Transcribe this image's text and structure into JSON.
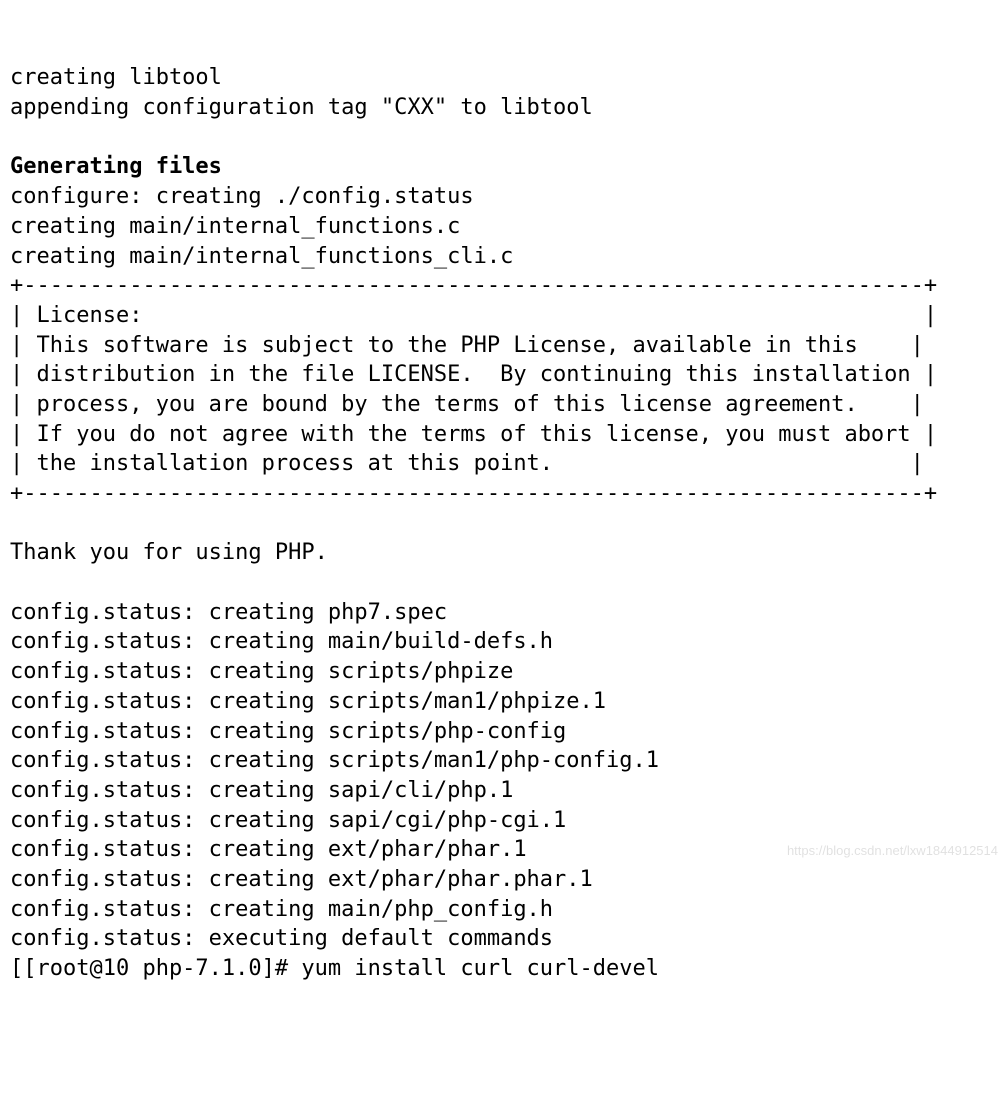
{
  "terminal": {
    "line01": "creating libtool",
    "line02": "appending configuration tag \"CXX\" to libtool",
    "blank1": "",
    "heading": "Generating files",
    "line03": "configure: creating ./config.status",
    "line04": "creating main/internal_functions.c",
    "line05": "creating main/internal_functions_cli.c",
    "box_top": "+--------------------------------------------------------------------+",
    "box_l1": "| License:                                                           |",
    "box_l2": "| This software is subject to the PHP License, available in this    |",
    "box_l3": "| distribution in the file LICENSE.  By continuing this installation |",
    "box_l4": "| process, you are bound by the terms of this license agreement.    |",
    "box_l5": "| If you do not agree with the terms of this license, you must abort |",
    "box_l6": "| the installation process at this point.                           |",
    "box_bot": "+--------------------------------------------------------------------+",
    "blank2": "",
    "line06": "Thank you for using PHP.",
    "blank3": "",
    "line07": "config.status: creating php7.spec",
    "line08": "config.status: creating main/build-defs.h",
    "line09": "config.status: creating scripts/phpize",
    "line10": "config.status: creating scripts/man1/phpize.1",
    "line11": "config.status: creating scripts/php-config",
    "line12": "config.status: creating scripts/man1/php-config.1",
    "line13": "config.status: creating sapi/cli/php.1",
    "line14": "config.status: creating sapi/cgi/php-cgi.1",
    "line15": "config.status: creating ext/phar/phar.1",
    "line16": "config.status: creating ext/phar/phar.phar.1",
    "line17": "config.status: creating main/php_config.h",
    "line18": "config.status: executing default commands",
    "prompt": "[[root@10 php-7.1.0]# yum install curl curl-devel"
  },
  "watermark": "https://blog.csdn.net/lxw1844912514"
}
